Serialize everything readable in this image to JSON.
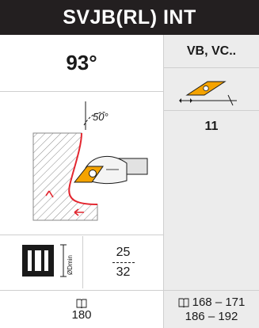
{
  "header": {
    "title": "SVJB(RL) INT"
  },
  "approach_angle": "93°",
  "insert": {
    "code": "VB, VC..",
    "size": "11"
  },
  "drawing": {
    "angle_label": "50°"
  },
  "bore": {
    "label": "ØDmin",
    "dmin_top": "25",
    "dmin_bottom": "32"
  },
  "refs": {
    "left_page": "180",
    "right_line1": "168 – 171",
    "right_line2": "186 – 192"
  },
  "colors": {
    "header_bg": "#231f20",
    "insert_fill": "#f5a300",
    "accent_red": "#e3262f",
    "panel_bg": "#ececec"
  },
  "icons": [
    "insert-icon",
    "book-icon",
    "boring-bar-icon"
  ]
}
